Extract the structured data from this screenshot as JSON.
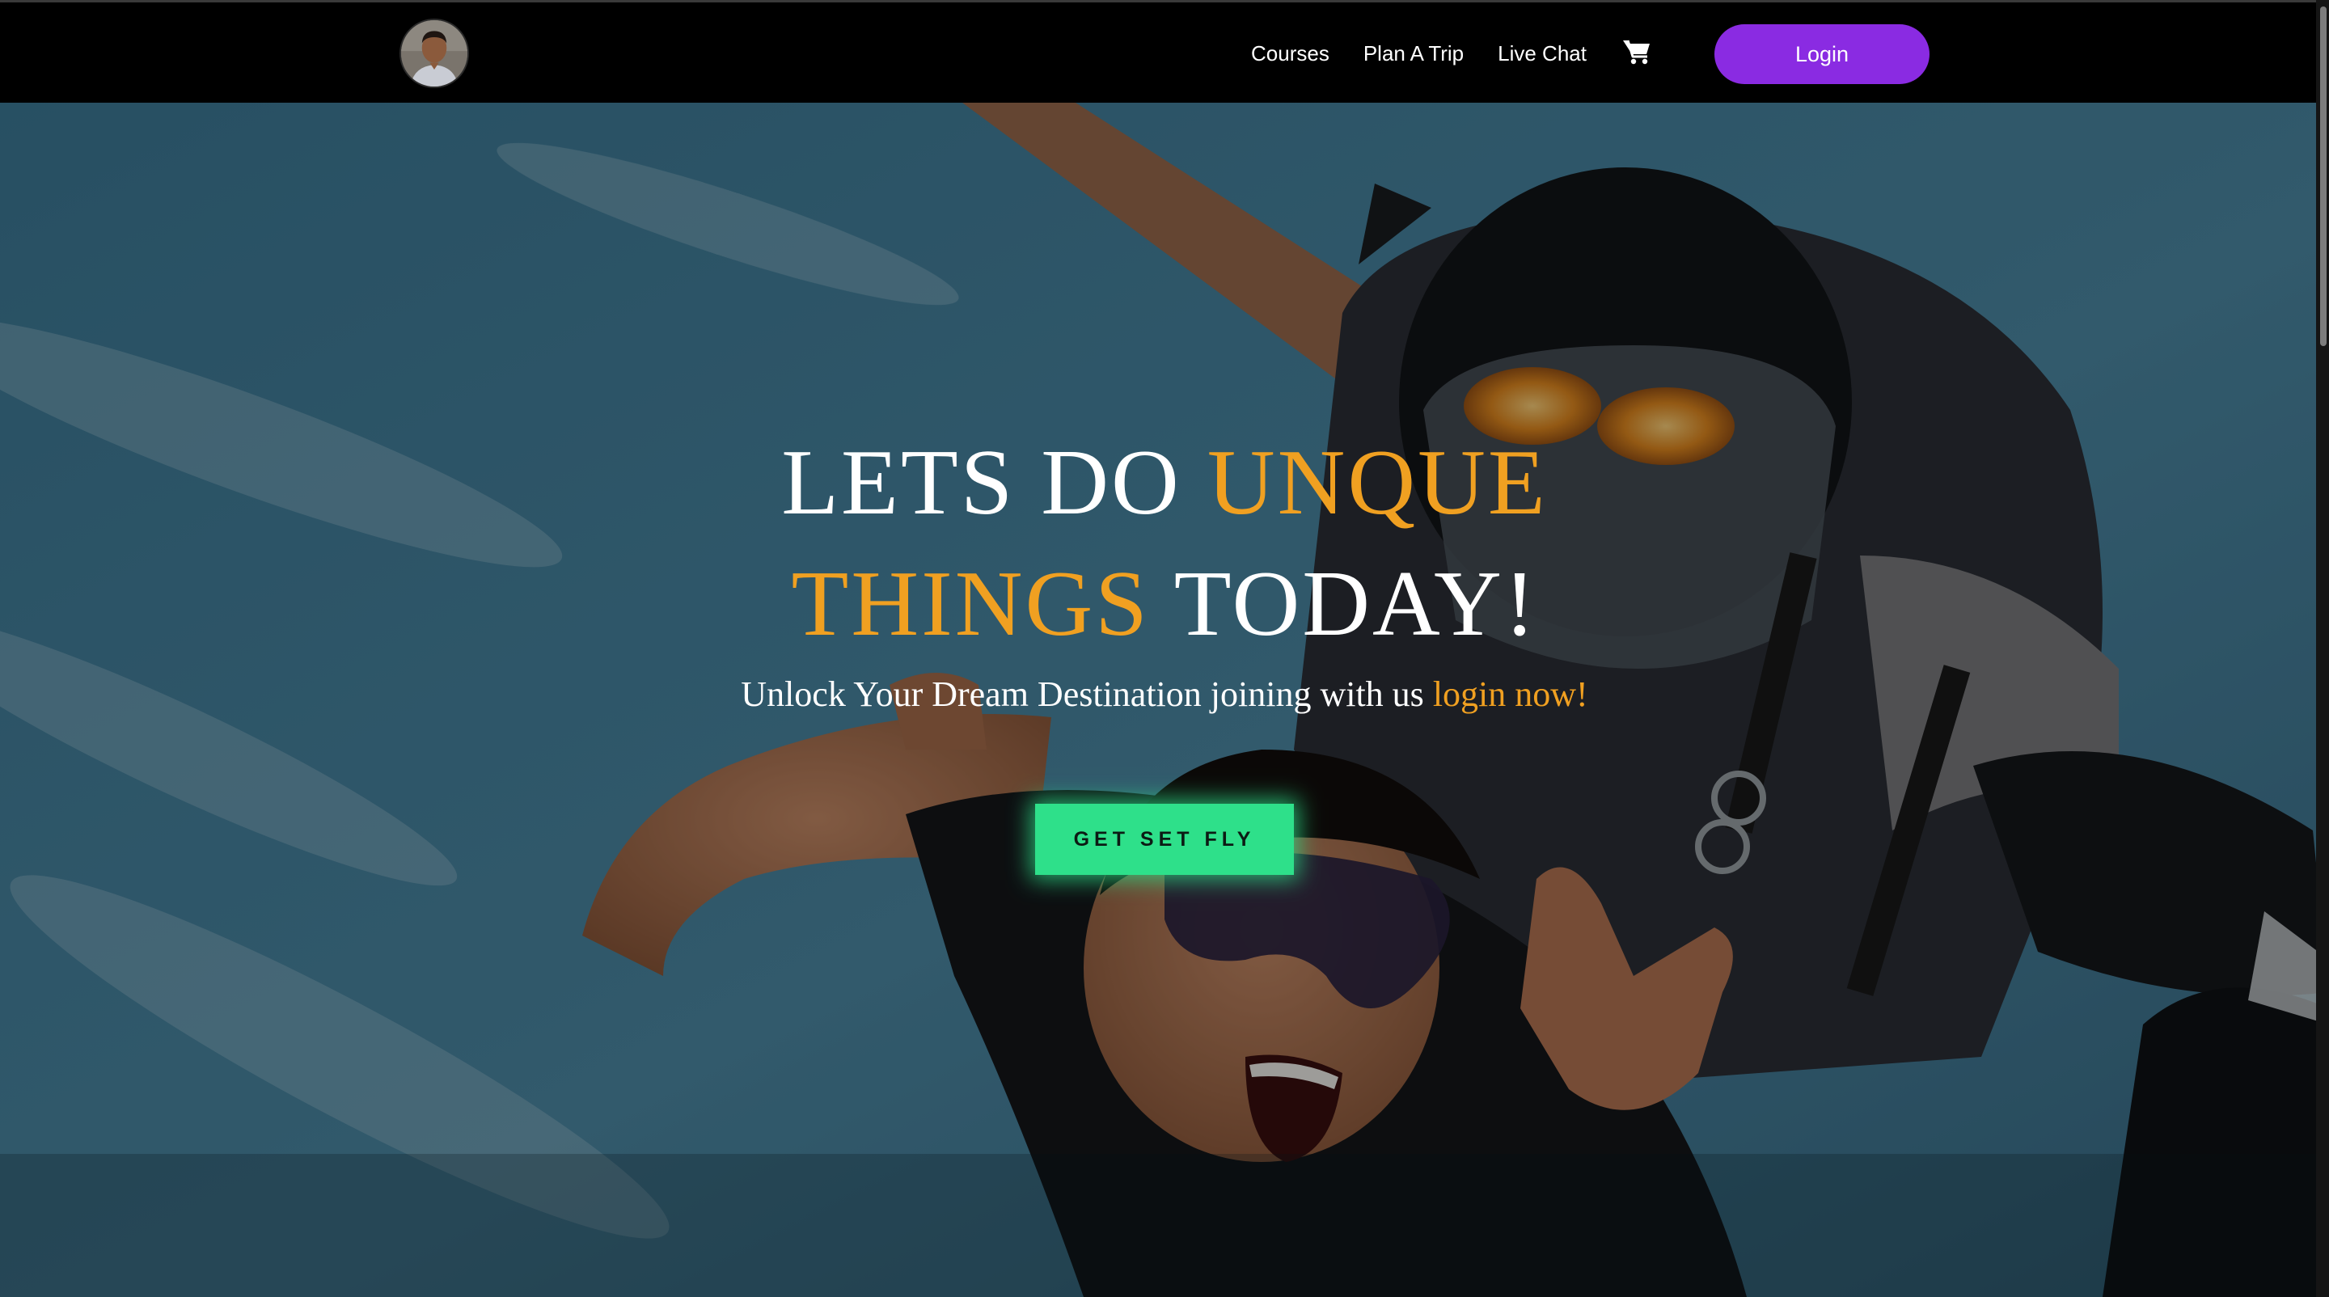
{
  "navbar": {
    "links": [
      "Courses",
      "Plan A Trip",
      "Live Chat"
    ],
    "cart_icon": "cart-icon",
    "login_label": "Login",
    "accent_color": "#8a2be2"
  },
  "hero": {
    "headline_part1": "LETS DO ",
    "headline_accent1": "UNQUE",
    "headline_accent2": "THINGS",
    "headline_part2": " TODAY!",
    "subline_text": "Unlock Your Dream Destination joining with us ",
    "subline_link": "login now!",
    "cta_label": "GET SET FLY",
    "accent_color": "#f0a021",
    "cta_color": "#2ee08a"
  }
}
